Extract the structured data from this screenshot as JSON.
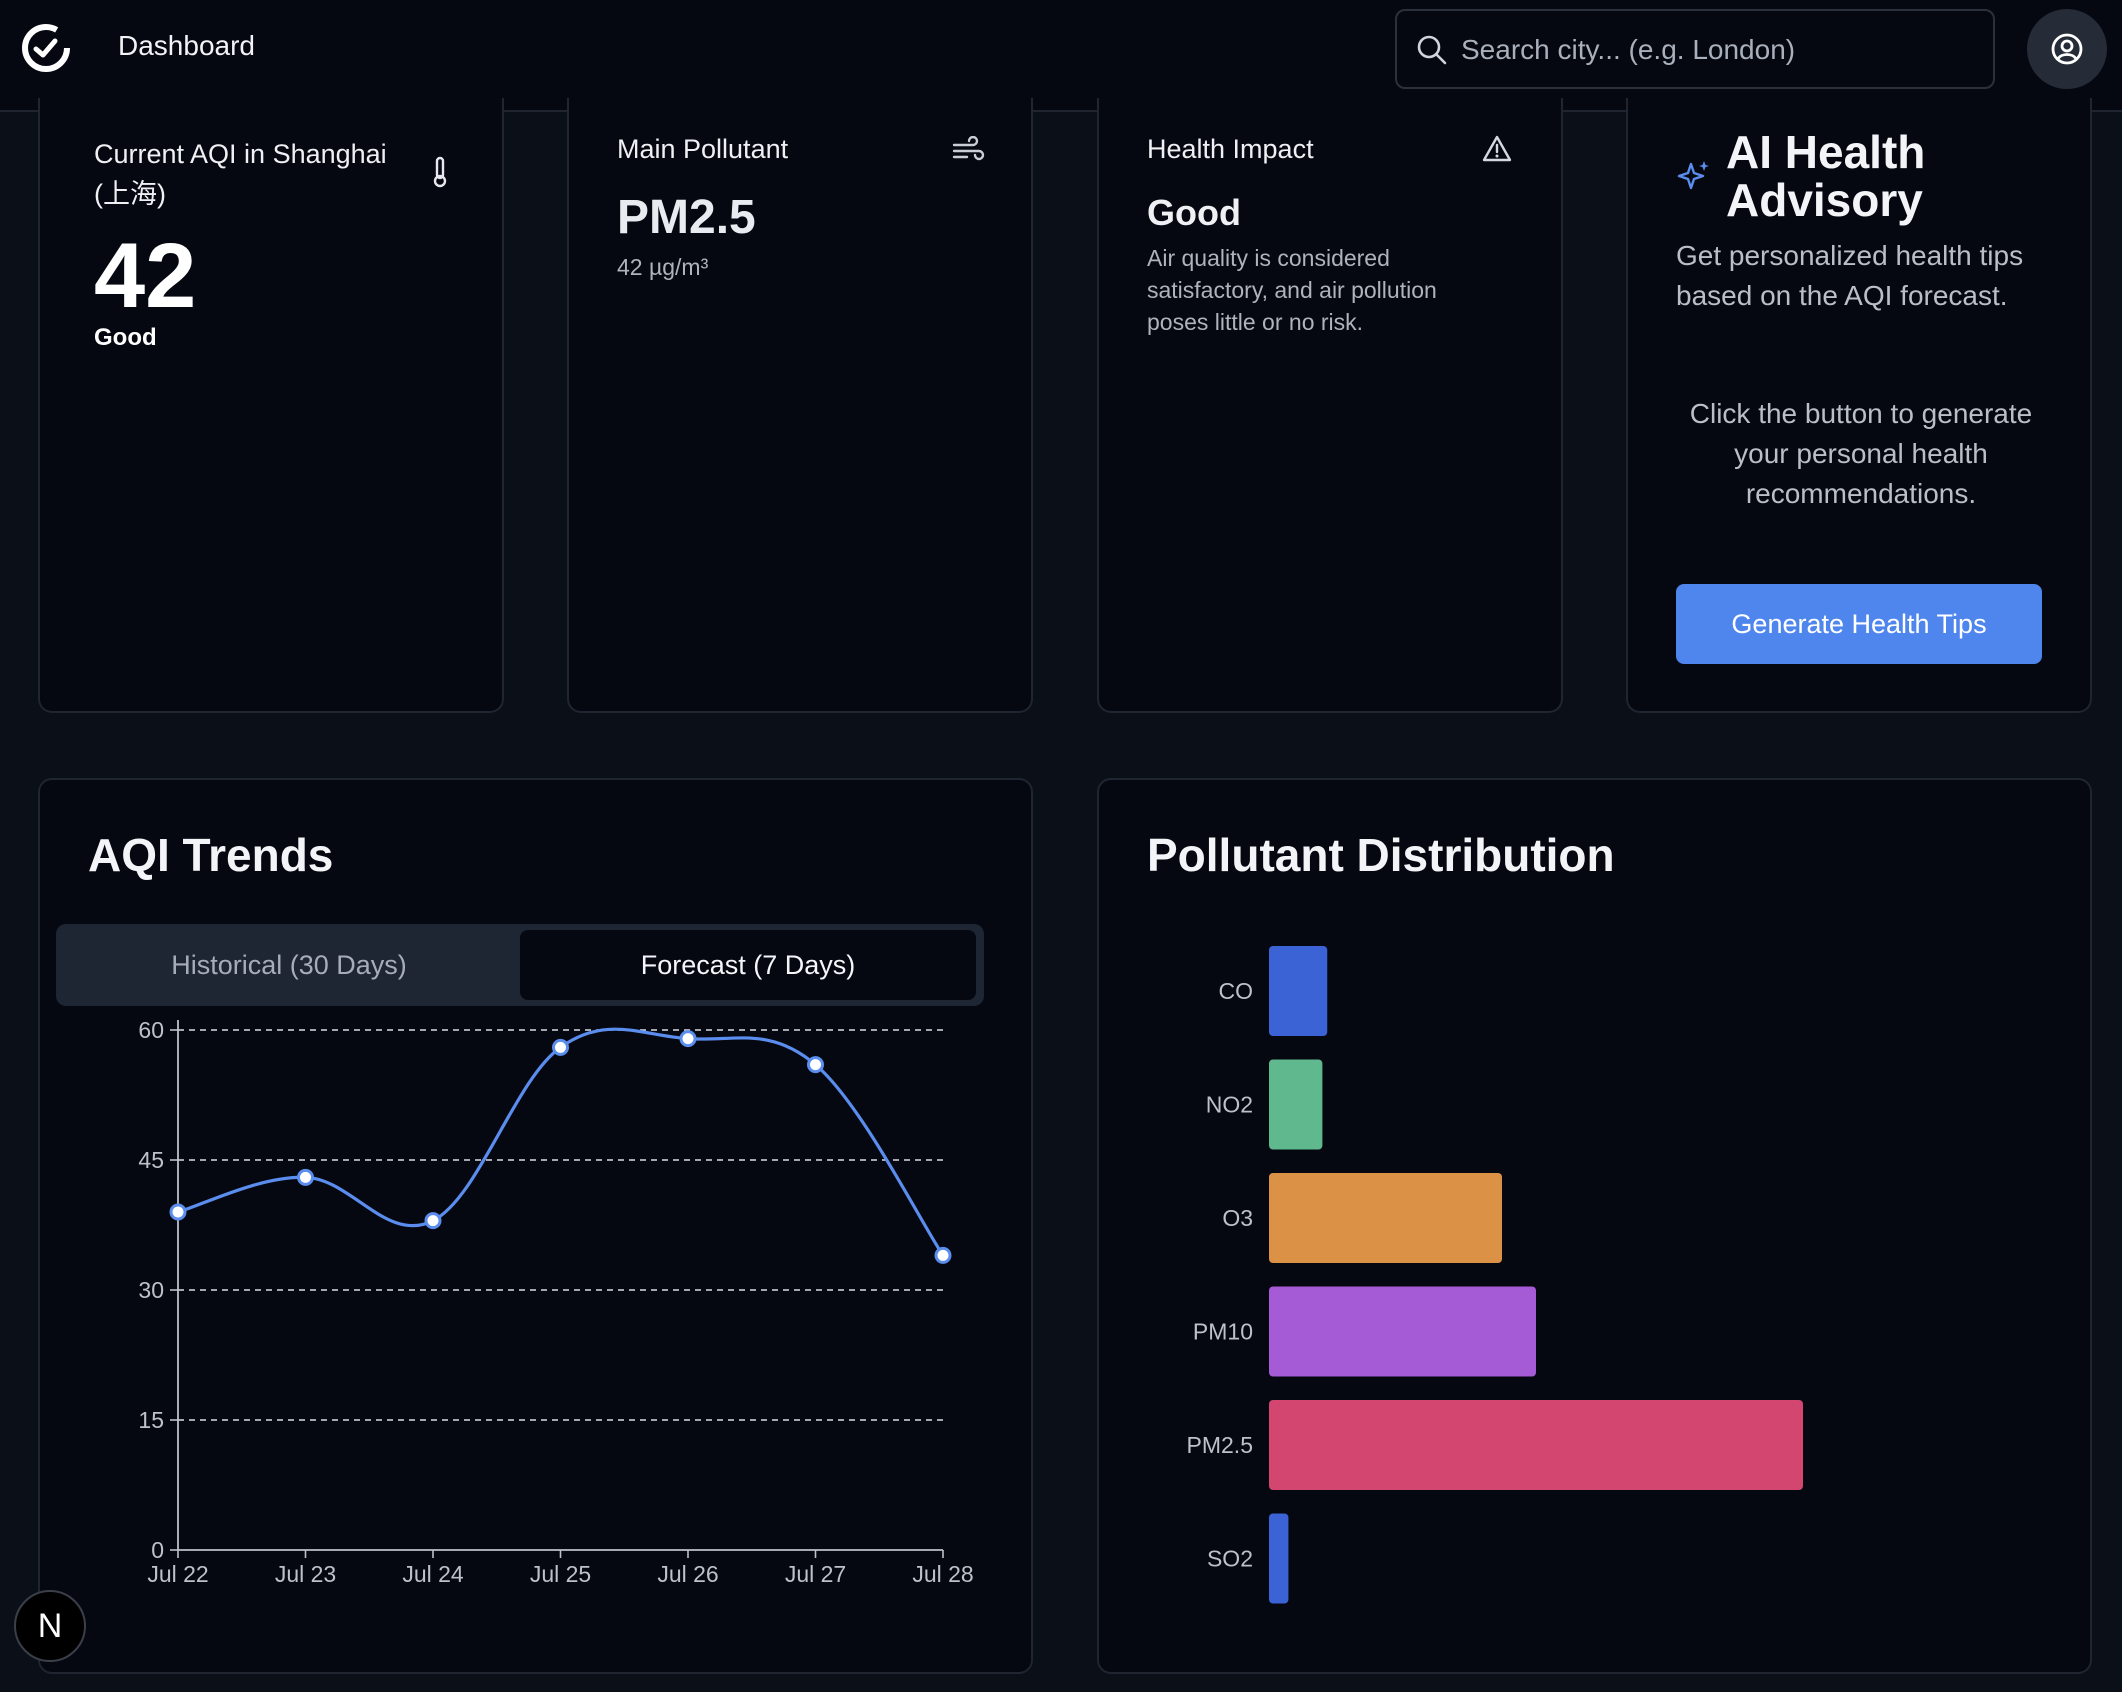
{
  "nav": {
    "title": "Dashboard",
    "search_placeholder": "Search city... (e.g. London)",
    "icons": {
      "logo": "logo-icon",
      "search": "search-icon",
      "user": "user-circle-icon"
    }
  },
  "cards": {
    "current_aqi": {
      "label": "Current AQI in Shanghai (上海)",
      "value": "42",
      "category": "Good",
      "icon": "thermometer-icon"
    },
    "main_pollutant": {
      "label": "Main Pollutant",
      "name": "PM2.5",
      "concentration": "42 µg/m³",
      "icon": "wind-icon"
    },
    "health_impact": {
      "label": "Health Impact",
      "status": "Good",
      "description": "Air quality is considered satisfactory, and air pollution poses little or no risk.",
      "icon": "alert-triangle-icon"
    },
    "ai_advisory": {
      "title": "AI Health Advisory",
      "subtitle": "Get personalized health tips based on the AQI forecast.",
      "prompt": "Click the button to generate your personal health recommendations.",
      "button": "Generate Health Tips",
      "icon": "sparkles-icon"
    }
  },
  "trends": {
    "title": "AQI Trends",
    "tabs": [
      {
        "label": "Historical (30 Days)",
        "active": false
      },
      {
        "label": "Forecast (7 Days)",
        "active": true
      }
    ]
  },
  "distribution": {
    "title": "Pollutant Distribution"
  },
  "badge": {
    "letter": "N"
  },
  "colors": {
    "line": "#5b8def",
    "accent_button": "#4f86ee",
    "co": "#3b63d6",
    "no2": "#5fb88e",
    "o3": "#dc9246",
    "pm10": "#a55ad6",
    "pm25": "#d2466f",
    "so2": "#3b63d6"
  },
  "chart_data": [
    {
      "type": "line",
      "x": [
        "Jul 22",
        "Jul 23",
        "Jul 24",
        "Jul 25",
        "Jul 26",
        "Jul 27",
        "Jul 28"
      ],
      "series": [
        {
          "values": [
            39,
            43,
            38,
            58,
            59,
            56,
            34
          ]
        }
      ],
      "yticks": [
        0,
        15,
        30,
        45,
        60
      ],
      "ylim": [
        0,
        60
      ],
      "grid": "dashed horizontal"
    },
    {
      "type": "bar",
      "orientation": "horizontal",
      "categories": [
        "CO",
        "NO2",
        "O3",
        "PM10",
        "PM2.5",
        "SO2"
      ],
      "values": [
        6,
        5.5,
        24,
        27.5,
        55,
        2
      ]
    }
  ]
}
